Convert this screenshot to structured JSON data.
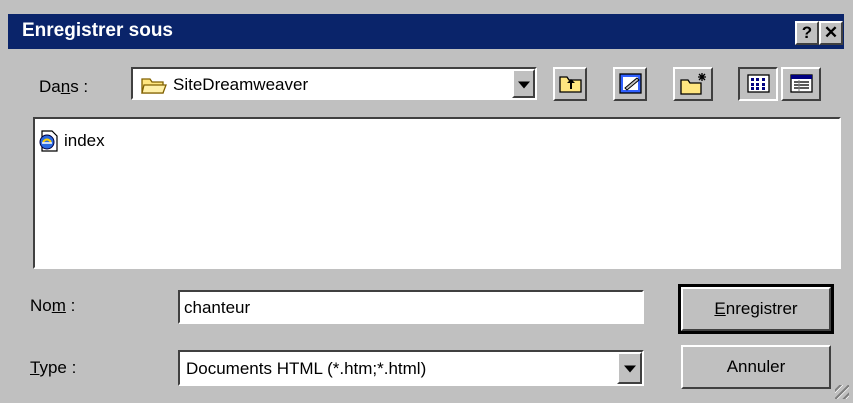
{
  "window": {
    "title": "Enregistrer sous",
    "help_label": "?",
    "close_label": "✕"
  },
  "location": {
    "label_pre": "Da",
    "label_underlined": "n",
    "label_post": "s :",
    "value": "SiteDreamweaver"
  },
  "toolbar": {
    "icons": [
      "up-one-level-icon",
      "web-folder-icon",
      "new-folder-icon",
      "list-view-icon",
      "details-view-icon"
    ]
  },
  "files": [
    {
      "name": "index",
      "icon": "html-document-icon"
    }
  ],
  "filename": {
    "label_pre": "No",
    "label_underlined": "m",
    "label_post": " :",
    "value": "chanteur"
  },
  "filetype": {
    "label_underlined": "T",
    "label_post": "ype :",
    "value": "Documents HTML (*.htm;*.html)"
  },
  "buttons": {
    "save_underlined": "E",
    "save_rest": "nregistrer",
    "cancel": "Annuler"
  },
  "colors": {
    "titlebar": "#0a246a",
    "face": "#c0c0c0"
  }
}
